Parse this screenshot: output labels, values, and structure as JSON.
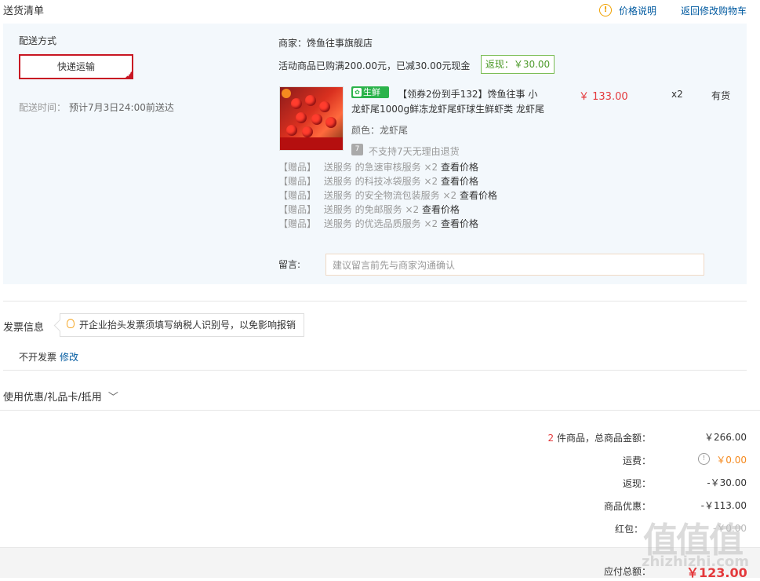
{
  "header": {
    "title": "送货清单",
    "price_note": "价格说明",
    "back_to_cart": "返回修改购物车"
  },
  "shipping": {
    "label": "配送方式",
    "method": "快递运输",
    "time_label": "配送时间：",
    "time_value": "预计7月3日24:00前送达"
  },
  "merchant": {
    "name": "商家：馋鱼往事旗舰店",
    "promo": "活动商品已购满200.00元，已减30.00元现金",
    "cashback": "返现：￥30.00"
  },
  "product": {
    "badge": "生鲜",
    "title_line1": "【领券2份到手132】馋鱼往事 小",
    "title_line2": "龙虾尾1000g鲜冻龙虾尾虾球生鲜虾类 龙虾尾",
    "color": "颜色：龙虾尾",
    "no_return": "不支持7天无理由退货",
    "price": "￥ 133.00",
    "qty": "x2",
    "stock": "有货"
  },
  "gifts": [
    {
      "tag": "【赠品】",
      "text": "送服务 的急速审核服务 ×2",
      "link": "查看价格"
    },
    {
      "tag": "【赠品】",
      "text": "送服务 的科技冰袋服务 ×2",
      "link": "查看价格"
    },
    {
      "tag": "【赠品】",
      "text": "送服务 的安全物流包装服务 ×2",
      "link": "查看价格"
    },
    {
      "tag": "【赠品】",
      "text": "送服务 的免邮服务 ×2",
      "link": "查看价格"
    },
    {
      "tag": "【赠品】",
      "text": "送服务 的优选品质服务 ×2",
      "link": "查看价格"
    }
  ],
  "message": {
    "label": "留言:",
    "placeholder": "建议留言前先与商家沟通确认"
  },
  "invoice": {
    "title": "发票信息",
    "tip": "开企业抬头发票须填写纳税人识别号，以免影响报销",
    "value": "不开发票",
    "edit": "修改"
  },
  "coupon": {
    "label": "使用优惠/礼品卡/抵用"
  },
  "summary": {
    "count": "2",
    "goods_label": "件商品，总商品金额：",
    "goods_value": "￥266.00",
    "freight_label": "运费：",
    "freight_value": "￥0.00",
    "cashback_label": "返现：",
    "cashback_value": "-￥30.00",
    "discount_label": "商品优惠：",
    "discount_value": "-￥113.00",
    "redpacket_label": "红包：",
    "redpacket_value": "-￥0.00",
    "total_label": "应付总额：",
    "total_value": "￥123.00"
  },
  "watermark": {
    "text": "zhizhizhi.com",
    "logo": "值值值"
  }
}
